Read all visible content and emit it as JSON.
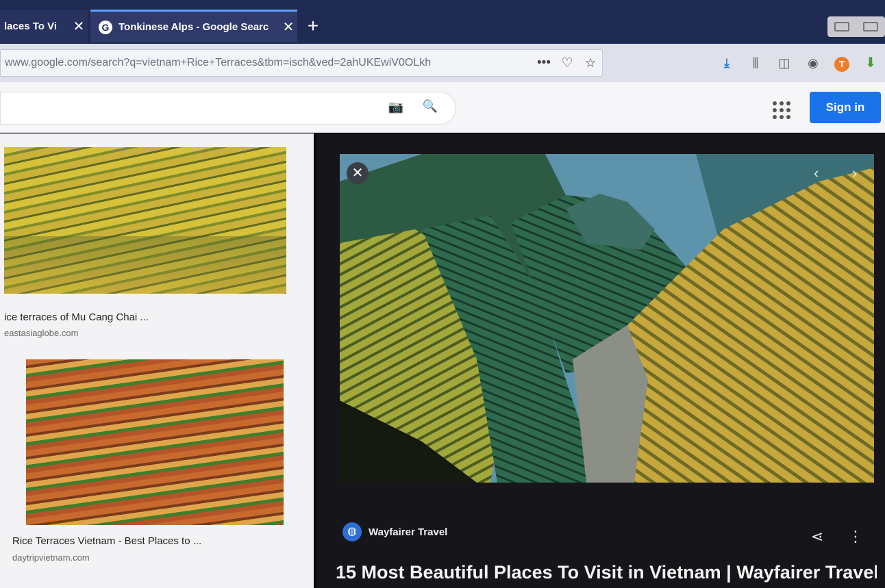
{
  "tabs": [
    {
      "label": "laces To Vi"
    },
    {
      "label": "Tonkinese Alps - Google Searc",
      "favicon": "G"
    }
  ],
  "url": "www.google.com/search?q=vietnam+Rice+Terraces&tbm=isch&ved=2ahUKEwiV0OLkh",
  "header": {
    "sign_in": "Sign in"
  },
  "results": [
    {
      "title": "ice terraces of Mu Cang Chai ...",
      "source": "eastasiaglobe.com"
    },
    {
      "title": "Rice Terraces Vietnam - Best Places to ...",
      "source": "daytripvietnam.com"
    }
  ],
  "preview": {
    "site": "Wayfairer Travel",
    "title": "15 Most Beautiful Places To Visit in Vietnam | Wayfairer Travel"
  },
  "icons": {
    "accent": "#1a73e8",
    "tab_bg": "#1f2a52"
  }
}
